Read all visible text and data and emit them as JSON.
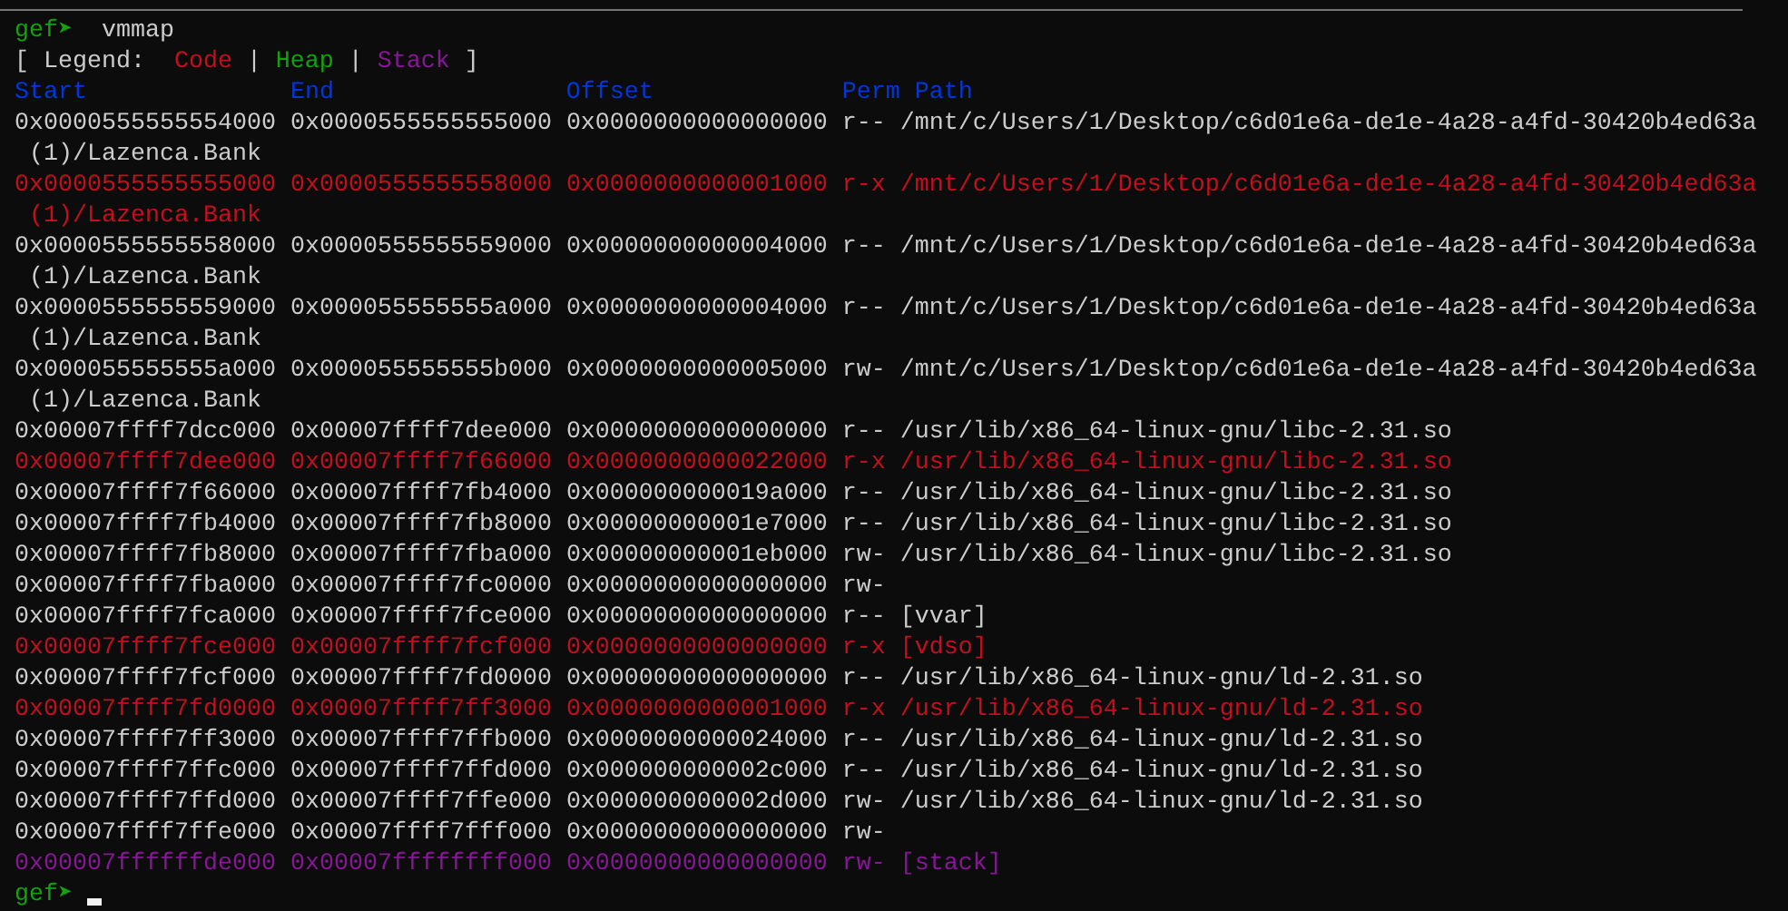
{
  "top_prompt": {
    "prompt": "gef➤",
    "command": "vmmap"
  },
  "legend": [
    {
      "kind": "text",
      "text": "[ Legend:"
    },
    {
      "kind": "entry",
      "text": "Code",
      "color": "#c50f1f"
    },
    {
      "kind": "text",
      "text": "|"
    },
    {
      "kind": "entry",
      "text": "Heap",
      "color": "#13a10e"
    },
    {
      "kind": "text",
      "text": "|"
    },
    {
      "kind": "entry",
      "text": "Stack",
      "color": "#881798"
    },
    {
      "kind": "text",
      "text": "]"
    }
  ],
  "columns": [
    "Start",
    "End",
    "Offset",
    "Perm",
    "Path"
  ],
  "rows": [
    {
      "kind": "plain",
      "start": "0x0000555555554000",
      "end": "0x0000555555555000",
      "offset": "0x0000000000000000",
      "perm": "r--",
      "path": "/mnt/c/Users/1/Desktop/c6d01e6a-de1e-4a28-a4fd-30420b4ed63a",
      "path_continued": "(1)/Lazenca.Bank"
    },
    {
      "kind": "code",
      "start": "0x0000555555555000",
      "end": "0x0000555555558000",
      "offset": "0x0000000000001000",
      "perm": "r-x",
      "path": "/mnt/c/Users/1/Desktop/c6d01e6a-de1e-4a28-a4fd-30420b4ed63a",
      "path_continued": "(1)/Lazenca.Bank"
    },
    {
      "kind": "plain",
      "start": "0x0000555555558000",
      "end": "0x0000555555559000",
      "offset": "0x0000000000004000",
      "perm": "r--",
      "path": "/mnt/c/Users/1/Desktop/c6d01e6a-de1e-4a28-a4fd-30420b4ed63a",
      "path_continued": "(1)/Lazenca.Bank"
    },
    {
      "kind": "plain",
      "start": "0x0000555555559000",
      "end": "0x000055555555a000",
      "offset": "0x0000000000004000",
      "perm": "r--",
      "path": "/mnt/c/Users/1/Desktop/c6d01e6a-de1e-4a28-a4fd-30420b4ed63a",
      "path_continued": "(1)/Lazenca.Bank"
    },
    {
      "kind": "plain",
      "start": "0x000055555555a000",
      "end": "0x000055555555b000",
      "offset": "0x0000000000005000",
      "perm": "rw-",
      "path": "/mnt/c/Users/1/Desktop/c6d01e6a-de1e-4a28-a4fd-30420b4ed63a",
      "path_continued": "(1)/Lazenca.Bank"
    },
    {
      "kind": "plain",
      "start": "0x00007ffff7dcc000",
      "end": "0x00007ffff7dee000",
      "offset": "0x0000000000000000",
      "perm": "r--",
      "path": "/usr/lib/x86_64-linux-gnu/libc-2.31.so"
    },
    {
      "kind": "code",
      "start": "0x00007ffff7dee000",
      "end": "0x00007ffff7f66000",
      "offset": "0x0000000000022000",
      "perm": "r-x",
      "path": "/usr/lib/x86_64-linux-gnu/libc-2.31.so"
    },
    {
      "kind": "plain",
      "start": "0x00007ffff7f66000",
      "end": "0x00007ffff7fb4000",
      "offset": "0x000000000019a000",
      "perm": "r--",
      "path": "/usr/lib/x86_64-linux-gnu/libc-2.31.so"
    },
    {
      "kind": "plain",
      "start": "0x00007ffff7fb4000",
      "end": "0x00007ffff7fb8000",
      "offset": "0x00000000001e7000",
      "perm": "r--",
      "path": "/usr/lib/x86_64-linux-gnu/libc-2.31.so"
    },
    {
      "kind": "plain",
      "start": "0x00007ffff7fb8000",
      "end": "0x00007ffff7fba000",
      "offset": "0x00000000001eb000",
      "perm": "rw-",
      "path": "/usr/lib/x86_64-linux-gnu/libc-2.31.so"
    },
    {
      "kind": "plain",
      "start": "0x00007ffff7fba000",
      "end": "0x00007ffff7fc0000",
      "offset": "0x0000000000000000",
      "perm": "rw-"
    },
    {
      "kind": "plain",
      "start": "0x00007ffff7fca000",
      "end": "0x00007ffff7fce000",
      "offset": "0x0000000000000000",
      "perm": "r--",
      "path": "[vvar]"
    },
    {
      "kind": "code",
      "start": "0x00007ffff7fce000",
      "end": "0x00007ffff7fcf000",
      "offset": "0x0000000000000000",
      "perm": "r-x",
      "path": "[vdso]"
    },
    {
      "kind": "plain",
      "start": "0x00007ffff7fcf000",
      "end": "0x00007ffff7fd0000",
      "offset": "0x0000000000000000",
      "perm": "r--",
      "path": "/usr/lib/x86_64-linux-gnu/ld-2.31.so"
    },
    {
      "kind": "code",
      "start": "0x00007ffff7fd0000",
      "end": "0x00007ffff7ff3000",
      "offset": "0x0000000000001000",
      "perm": "r-x",
      "path": "/usr/lib/x86_64-linux-gnu/ld-2.31.so"
    },
    {
      "kind": "plain",
      "start": "0x00007ffff7ff3000",
      "end": "0x00007ffff7ffb000",
      "offset": "0x0000000000024000",
      "perm": "r--",
      "path": "/usr/lib/x86_64-linux-gnu/ld-2.31.so"
    },
    {
      "kind": "plain",
      "start": "0x00007ffff7ffc000",
      "end": "0x00007ffff7ffd000",
      "offset": "0x000000000002c000",
      "perm": "r--",
      "path": "/usr/lib/x86_64-linux-gnu/ld-2.31.so"
    },
    {
      "kind": "plain",
      "start": "0x00007ffff7ffd000",
      "end": "0x00007ffff7ffe000",
      "offset": "0x000000000002d000",
      "perm": "rw-",
      "path": "/usr/lib/x86_64-linux-gnu/ld-2.31.so"
    },
    {
      "kind": "plain",
      "start": "0x00007ffff7ffe000",
      "end": "0x00007ffff7fff000",
      "offset": "0x0000000000000000",
      "perm": "rw-"
    },
    {
      "kind": "stack",
      "start": "0x00007ffffffde000",
      "end": "0x00007ffffffff000",
      "offset": "0x0000000000000000",
      "perm": "rw-",
      "path": "[stack]"
    }
  ],
  "bottom_prompt": {
    "prompt": "gef➤"
  }
}
